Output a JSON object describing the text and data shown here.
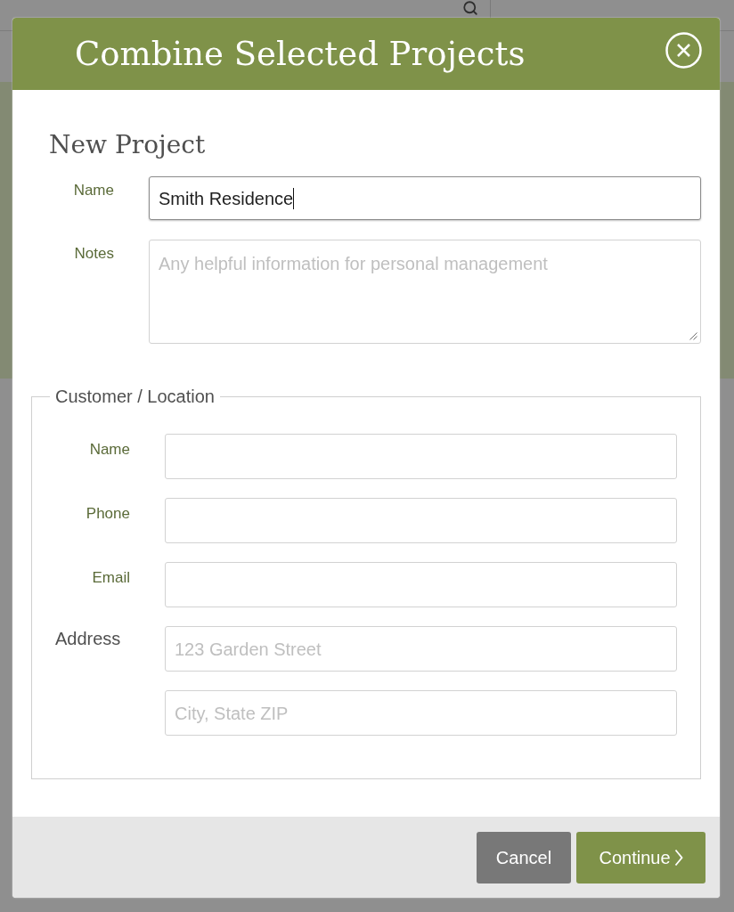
{
  "dialog": {
    "title": "Combine Selected Projects"
  },
  "new_project": {
    "heading": "New Project",
    "fields": [
      {
        "kind": "input",
        "label": "Name",
        "value": "Smith Residence",
        "focused": true
      },
      {
        "kind": "textarea",
        "label": "Notes",
        "placeholder": "Any helpful information for personal management",
        "focused": false
      }
    ]
  },
  "customer_location": {
    "legend": "Customer / Location",
    "fields": [
      {
        "kind": "contact",
        "label": "Name"
      },
      {
        "kind": "contact",
        "label": "Phone"
      },
      {
        "kind": "contact",
        "label": "Email"
      },
      {
        "kind": "address",
        "label": "Address",
        "placeholder": "123 Garden Street"
      },
      {
        "kind": "address",
        "placeholder": "City, State ZIP"
      }
    ]
  },
  "buttons": [
    {
      "kind": "secondary",
      "label": "Cancel"
    },
    {
      "kind": "primary",
      "label": "Continue"
    }
  ]
}
